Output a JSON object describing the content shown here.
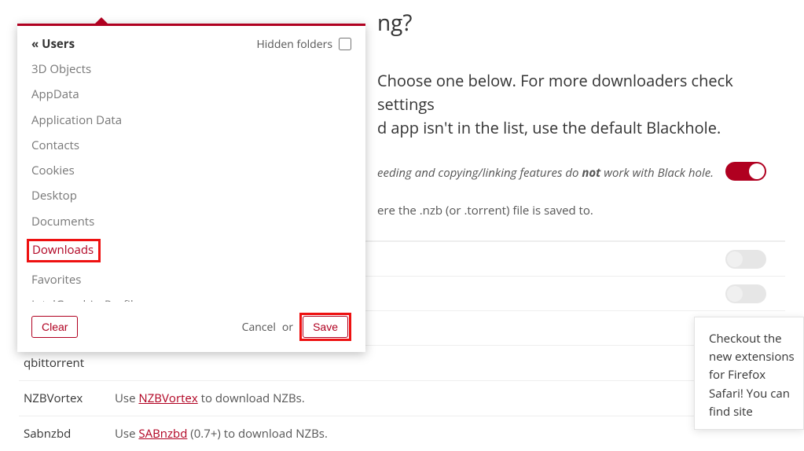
{
  "title_fragment": "ng?",
  "desc_line1_frag": "Choose one below. For more downloaders check settings",
  "desc_line2_frag": "d app isn't in the list, use the default Blackhole.",
  "note_pre": "eeding and copying/linking features do ",
  "note_not": "not",
  "note_post": " work with Black hole.",
  "sub_note": "ere the .nzb (or .torrent) file is saved to.",
  "popover": {
    "breadcrumb_prefix": "« ",
    "breadcrumb": "Users",
    "hidden_label": "Hidden folders",
    "folders": [
      "3D Objects",
      "AppData",
      "Application Data",
      "Contacts",
      "Cookies",
      "Desktop",
      "Documents",
      "Downloads",
      "Favorites",
      "IntelGraphicsProfiles"
    ],
    "selected_index": 7,
    "clear_label": "Clear",
    "cancel_label": "Cancel",
    "or_label": "or",
    "save_label": "Save"
  },
  "rows": {
    "qbittorrent": {
      "label": "qbittorrent"
    },
    "nzbvortex": {
      "label": "NZBVortex",
      "pre": "Use ",
      "link": "NZBVortex",
      "post": " to download NZBs."
    },
    "sabnzbd": {
      "label": "Sabnzbd",
      "pre": "Use ",
      "link": "SABnzbd",
      "post": " (0.7+) to download NZBs."
    }
  },
  "notification": "Checkout the new extensions for Firefox Safari! You can find site"
}
